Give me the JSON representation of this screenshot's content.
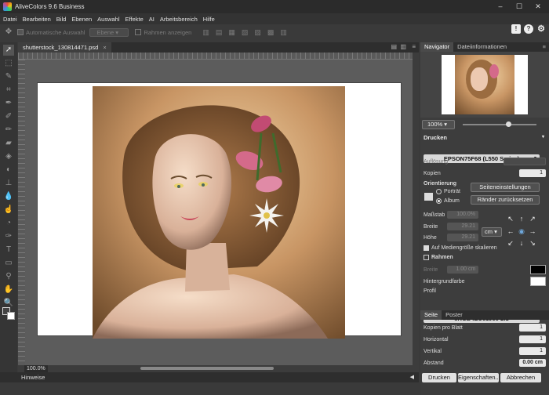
{
  "window": {
    "title": "AliveColors 9.6 Business",
    "minimize": "–",
    "maximize": "☐",
    "close": "✕"
  },
  "menu": [
    "Datei",
    "Bearbeiten",
    "Bild",
    "Ebenen",
    "Auswahl",
    "Effekte",
    "AI",
    "Arbeitsbereich",
    "Hilfe"
  ],
  "options": {
    "auto_select": "Automatische Auswahl",
    "layer_select": "Ebene",
    "show_frames": "Rahmen anzeigen"
  },
  "document": {
    "tab": "shutterstock_130814471.psd",
    "close": "×",
    "zoom": "100.0%"
  },
  "hints": {
    "label": "Hinweise",
    "arrow": "◀"
  },
  "panel": {
    "tabs": [
      "Navigator",
      "Dateiinformationen"
    ],
    "zoom": "100%",
    "print_section": "Drucken",
    "printer": "EPSON75F68 (L550 Series)",
    "resolution_label": "Auflösung",
    "copies_label": "Kopien",
    "copies": "1",
    "orientation_label": "Orientierung",
    "portrait": "Porträt",
    "landscape": "Album",
    "page_setup": "Seiteneinstellungen",
    "reset_margins": "Ränder zurücksetzen",
    "scale_label": "Maßstab",
    "scale": "100.0%",
    "width_label": "Breite",
    "width": "29.21",
    "height_label": "Höhe",
    "height": "29.21",
    "unit": "cm",
    "fit_media": "Auf Mediengröße skalieren",
    "frame_label": "Rahmen",
    "frame_width_label": "Breite",
    "frame_width": "1.00 cm",
    "bg_label": "Hintergrundfarbe",
    "profile_label": "Profil",
    "profile": "sRGB IEC61966-2.1",
    "subtabs": [
      "Seite",
      "Poster"
    ],
    "copies_per_sheet_label": "Kopien pro Blatt",
    "copies_per_sheet": "1",
    "horizontal_label": "Horizontal",
    "horizontal": "1",
    "vertical_label": "Vertikal",
    "vertical": "1",
    "spacing_label": "Abstand",
    "spacing": "0.00 cm",
    "print_btn": "Drucken",
    "props_btn": "Eigenschaften...",
    "cancel_btn": "Abbrechen",
    "colors": {
      "frame": "#000000",
      "background": "#ffffff"
    }
  }
}
